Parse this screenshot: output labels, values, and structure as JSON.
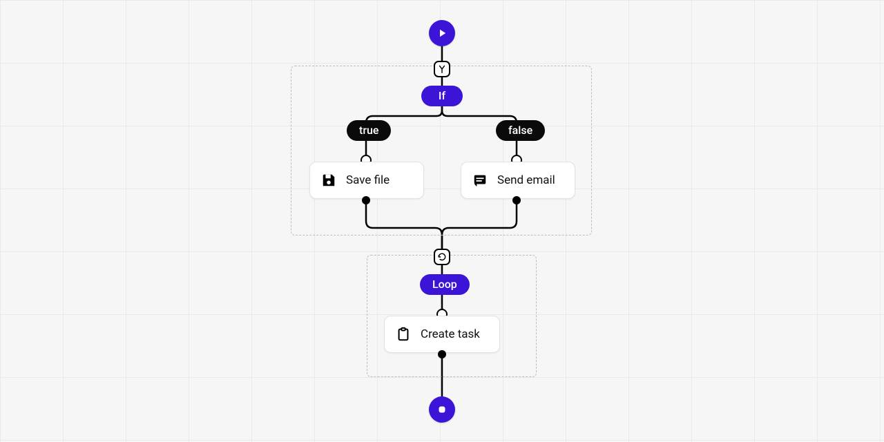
{
  "flow": {
    "if_label": "If",
    "true_label": "true",
    "false_label": "false",
    "loop_label": "Loop",
    "actions": {
      "save_file": "Save file",
      "send_email": "Send email",
      "create_task": "Create task"
    }
  }
}
